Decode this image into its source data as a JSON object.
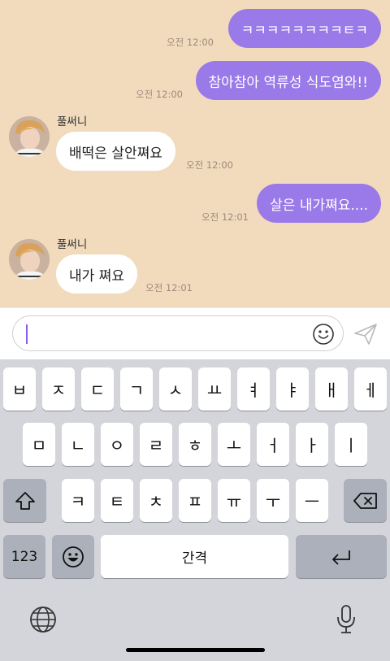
{
  "chat": {
    "messages": [
      {
        "dir": "out",
        "text": "ㅋㅋㅋㅋㅋㅋㅋㅋㅌㅋ",
        "time": "오전 12:00"
      },
      {
        "dir": "out",
        "text": "참아참아 역류성 식도염와!!",
        "time": "오전 12:00"
      },
      {
        "dir": "in",
        "sender": "풀써니",
        "text": "배떡은 살안쪄요",
        "time": "오전 12:00"
      },
      {
        "dir": "out",
        "text": "살은 내가쪄요....",
        "time": "오전 12:01"
      },
      {
        "dir": "in",
        "sender": "풀써니",
        "text": "내가 쪄요",
        "time": "오전 12:01"
      }
    ]
  },
  "input": {
    "value": "",
    "placeholder": ""
  },
  "icons": {
    "emoji": "smiley-icon",
    "send": "send-paper-plane-icon",
    "shift": "shift-arrow-icon",
    "backspace": "backspace-icon",
    "emoji_key": "emoji-key-icon",
    "return": "return-arrow-icon",
    "globe": "globe-icon",
    "mic": "microphone-icon"
  },
  "keyboard": {
    "row1": [
      "ㅂ",
      "ㅈ",
      "ㄷ",
      "ㄱ",
      "ㅅ",
      "ㅛ",
      "ㅕ",
      "ㅑ",
      "ㅐ",
      "ㅔ"
    ],
    "row2": [
      "ㅁ",
      "ㄴ",
      "ㅇ",
      "ㄹ",
      "ㅎ",
      "ㅗ",
      "ㅓ",
      "ㅏ",
      "ㅣ"
    ],
    "row3": [
      "ㅋ",
      "ㅌ",
      "ㅊ",
      "ㅍ",
      "ㅠ",
      "ㅜ",
      "ㅡ"
    ],
    "numbers_label": "123",
    "space_label": "간격"
  },
  "colors": {
    "chat_bg": "#f2dbbd",
    "outgoing_bubble": "#9a79e8",
    "incoming_bubble": "#ffffff",
    "keyboard_bg": "#d3d5db",
    "caret": "#8a5cf0"
  }
}
